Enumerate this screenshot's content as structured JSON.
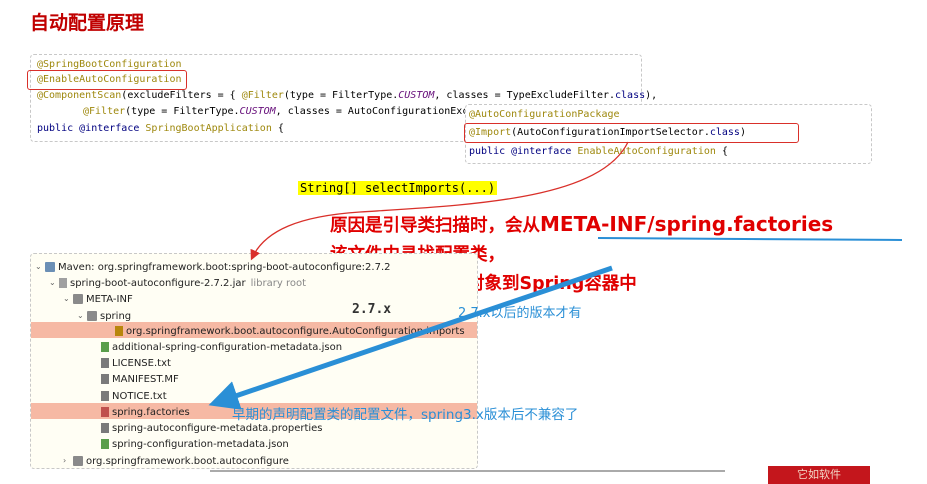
{
  "title": "自动配置原理",
  "code1": {
    "line1": "@SpringBootConfiguration",
    "line2": "@EnableAutoConfiguration",
    "line3_anno": "@ComponentScan",
    "line3_rest": "(excludeFilters = { ",
    "line3_f": "@Filter",
    "line3_a": "(type = FilterType.",
    "line3_custom": "CUSTOM",
    "line3_b": ", classes = TypeExcludeFilter.",
    "line3_kw": "class",
    "line3_c": "),",
    "line4_f": "@Filter",
    "line4_a": "(type = FilterType.",
    "line4_custom": "CUSTOM",
    "line4_b": ", classes = AutoConfigurationExcl",
    "line5_kw": "public",
    "line5_iface": "@interface",
    "line5_name": "SpringBootApplication",
    "line5_brace": "{"
  },
  "code2": {
    "line1": "@AutoConfigurationPackage",
    "line2_anno": "@Import",
    "line2_a": "(AutoConfigurationImportSelector.",
    "line2_kw": "class",
    "line2_b": ")",
    "line3_kw": "public",
    "line3_iface": "@interface",
    "line3_name": "EnableAutoConfiguration",
    "line3_brace": "{"
  },
  "select_imports": "String[] selectImports(...)",
  "explanation": {
    "line1_a": "原因是引导类扫描时，会从",
    "line1_b": "META-INF/spring.factories",
    "line2": "该文件中寻找配置类，",
    "line3": "注入其中的Bean对象到Spring容器中"
  },
  "version_label": "2.7.x",
  "version_note": "2.7.x以后的版本才有",
  "early_note": "早期的声明配置类的配置文件，spring3.x版本后不兼容了",
  "tree": [
    {
      "label": "Maven: org.springframework.boot:spring-boot-autoconfigure:2.7.2",
      "icon": "library-icon",
      "chev": "v"
    },
    {
      "label": "spring-boot-autoconfigure-2.7.2.jar",
      "suffix": "library root",
      "icon": "jar-icon",
      "chev": "v"
    },
    {
      "label": "META-INF",
      "icon": "folder-icon",
      "chev": "v"
    },
    {
      "label": "spring",
      "icon": "folder-icon",
      "chev": "v"
    },
    {
      "label": "org.springframework.boot.autoconfigure.AutoConfiguration.imports",
      "icon": "file-icon",
      "chev": ""
    },
    {
      "label": "additional-spring-configuration-metadata.json",
      "icon": "json-icon",
      "chev": ""
    },
    {
      "label": "LICENSE.txt",
      "icon": "text-file-icon",
      "chev": ""
    },
    {
      "label": "MANIFEST.MF",
      "icon": "manifest-icon",
      "chev": ""
    },
    {
      "label": "NOTICE.txt",
      "icon": "text-file-icon",
      "chev": ""
    },
    {
      "label": "spring.factories",
      "icon": "factories-icon",
      "chev": ""
    },
    {
      "label": "spring-autoconfigure-metadata.properties",
      "icon": "properties-icon",
      "chev": ""
    },
    {
      "label": "spring-configuration-metadata.json",
      "icon": "json-icon",
      "chev": ""
    },
    {
      "label": "org.springframework.boot.autoconfigure",
      "icon": "package-icon",
      "chev": ">"
    }
  ],
  "brand": "它如软件",
  "colors": {
    "title": "#c00000",
    "red_annotation": "#e00000",
    "blue_annotation": "#2a8fd6",
    "highlight_row": "#f6b9a4",
    "yellow_highlight": "#ffff00"
  }
}
